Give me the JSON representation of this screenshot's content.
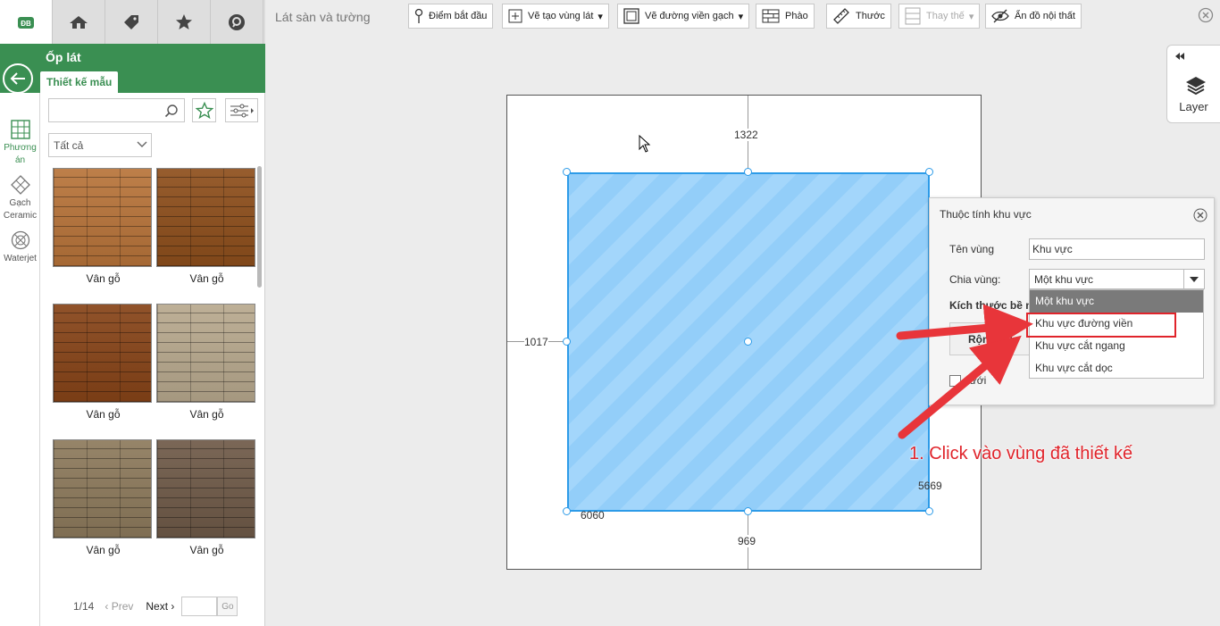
{
  "nav_tabs": [
    {
      "icon": "logo-icon",
      "active": true
    },
    {
      "icon": "house-icon"
    },
    {
      "icon": "tag-icon"
    },
    {
      "icon": "star-icon"
    },
    {
      "icon": "search-circle-icon"
    }
  ],
  "panel": {
    "title": "Ốp lát",
    "tab": "Thiết kế mẫu",
    "search_placeholder": "",
    "filter_value": "Tất cả",
    "tiles": [
      {
        "caption": "Vân gỗ",
        "color": "#b8743a"
      },
      {
        "caption": "Vân gỗ",
        "color": "#8e4f1c"
      },
      {
        "caption": "Vân gỗ",
        "color": "#874418"
      },
      {
        "caption": "Vân gỗ",
        "color": "#b8a98e"
      },
      {
        "caption": "Vân gỗ",
        "color": "#8d7a5c"
      },
      {
        "caption": "Vân gỗ",
        "color": "#6f5a48"
      }
    ],
    "pager": {
      "page": "1/14",
      "prev": "Prev",
      "next": "Next",
      "go": "Go"
    }
  },
  "side_nav": [
    {
      "label": "Phương án",
      "active": true
    },
    {
      "label": "Gạch Ceramic"
    },
    {
      "label": "Waterjet"
    }
  ],
  "toolbar": {
    "title": "Lát sàn và tường",
    "buttons": [
      {
        "label": "Điểm bắt đầu",
        "icon": "pin-icon"
      },
      {
        "label": "Vẽ tạo vùng lát",
        "icon": "draw-area-icon",
        "dropdown": true
      },
      {
        "label": "Vẽ đường viền gạch",
        "icon": "border-icon",
        "dropdown": true
      },
      {
        "label": "Phào",
        "icon": "molding-icon"
      },
      {
        "label": "Thước",
        "icon": "ruler-icon"
      },
      {
        "label": "Thay thế",
        "icon": "replace-icon",
        "dropdown": true,
        "disabled": true
      },
      {
        "label": "Ẩn đồ nội thất",
        "icon": "hide-furniture-icon"
      }
    ]
  },
  "canvas": {
    "dim_top": "1322",
    "dim_left": "1017",
    "dim_right": "5669",
    "dim_bottom_inner": "6060",
    "dim_bottom": "969"
  },
  "layer_panel": {
    "label": "Layer"
  },
  "properties": {
    "title": "Thuộc tính khu vực",
    "name_label": "Tên vùng",
    "name_value": "Khu vực",
    "split_label": "Chia vùng:",
    "split_value": "Một khu vực",
    "size_label": "Kích thước bề m",
    "width_label": "Rộng(W):",
    "grid_label": "lưới",
    "options": [
      "Một khu vực",
      "Khu vực đường viền",
      "Khu vực cắt ngang",
      "Khu vực cắt dọc"
    ]
  },
  "annotation": "1. Click vào vùng đã thiết kế",
  "colors": {
    "brand_green": "#3a8f52",
    "area_blue": "#93cef9",
    "highlight_red": "#e0242b"
  }
}
